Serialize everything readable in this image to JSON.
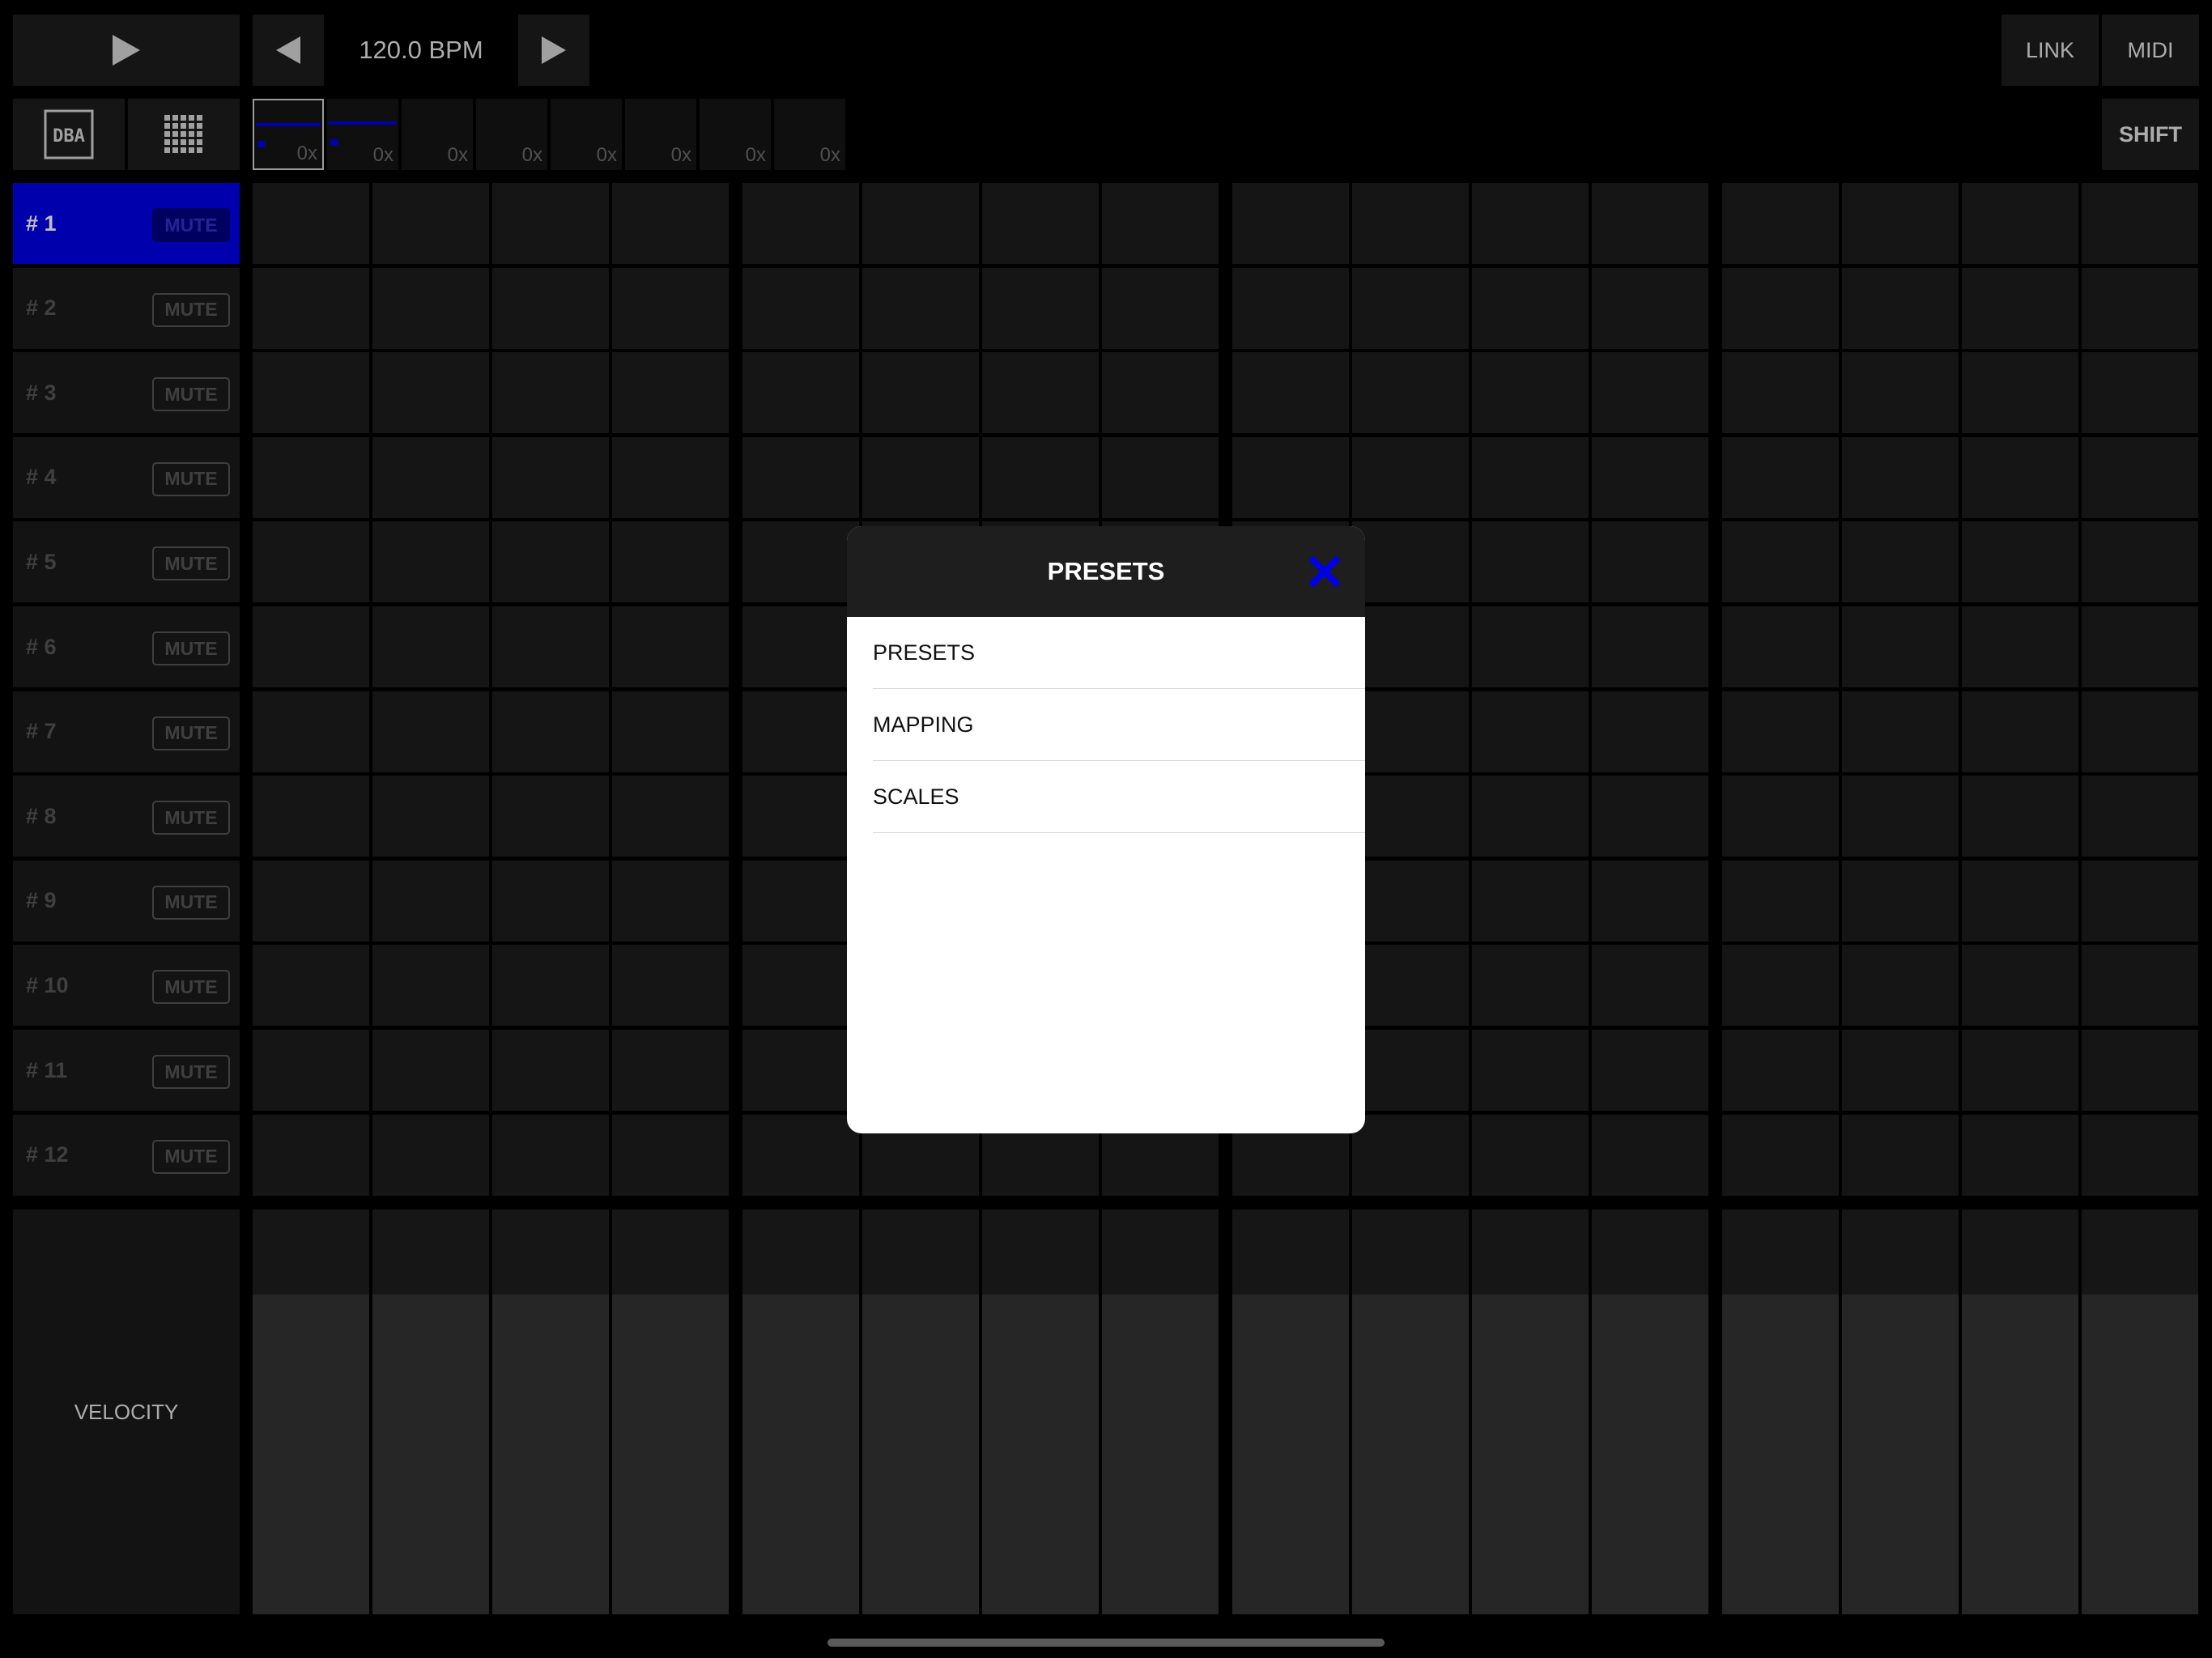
{
  "transport": {
    "play_icon": "play-icon",
    "tempo_down_icon": "triangle-left-icon",
    "tempo_up_icon": "triangle-right-icon",
    "bpm": "120.0 BPM"
  },
  "top_right": {
    "link_label": "LINK",
    "midi_label": "MIDI",
    "shift_label": "SHIFT"
  },
  "view_buttons": {
    "logo_icon": "dba-logo-icon",
    "grid_icon": "grid-icon"
  },
  "patterns": [
    {
      "label": "0x",
      "selected": true
    },
    {
      "label": "0x",
      "selected": false
    },
    {
      "label": "0x",
      "selected": false
    },
    {
      "label": "0x",
      "selected": false
    },
    {
      "label": "0x",
      "selected": false
    },
    {
      "label": "0x",
      "selected": false
    },
    {
      "label": "0x",
      "selected": false
    },
    {
      "label": "0x",
      "selected": false
    }
  ],
  "tracks": [
    {
      "label": "# 1",
      "mute": "MUTE",
      "active": true
    },
    {
      "label": "# 2",
      "mute": "MUTE",
      "active": false
    },
    {
      "label": "# 3",
      "mute": "MUTE",
      "active": false
    },
    {
      "label": "# 4",
      "mute": "MUTE",
      "active": false
    },
    {
      "label": "# 5",
      "mute": "MUTE",
      "active": false
    },
    {
      "label": "# 6",
      "mute": "MUTE",
      "active": false
    },
    {
      "label": "# 7",
      "mute": "MUTE",
      "active": false
    },
    {
      "label": "# 8",
      "mute": "MUTE",
      "active": false
    },
    {
      "label": "# 9",
      "mute": "MUTE",
      "active": false
    },
    {
      "label": "# 10",
      "mute": "MUTE",
      "active": false
    },
    {
      "label": "# 11",
      "mute": "MUTE",
      "active": false
    },
    {
      "label": "# 12",
      "mute": "MUTE",
      "active": false
    }
  ],
  "step_count": 16,
  "velocity": {
    "label": "VELOCITY",
    "level": 0.79
  },
  "modal": {
    "title": "PRESETS",
    "close_icon": "close-icon",
    "items": [
      "PRESETS",
      "MAPPING",
      "SCALES"
    ]
  },
  "colors": {
    "accent": "#0000e6",
    "background": "#000000",
    "cell": "#1c1c1c"
  }
}
